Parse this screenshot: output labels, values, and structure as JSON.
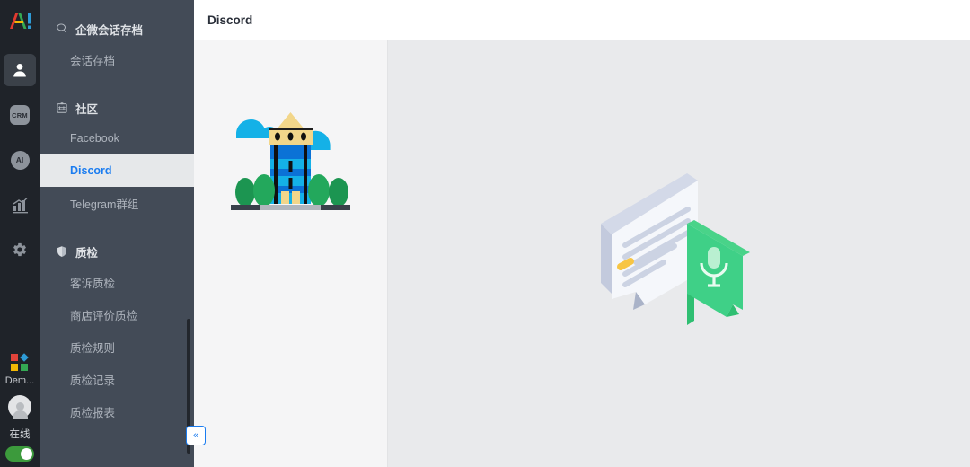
{
  "colors": {
    "rail_bg": "#1f2329",
    "nav_bg": "#434b57",
    "active_item_bg": "#e6e8ea",
    "accent_blue": "#1a7cf0",
    "status_green": "#3c9a3c",
    "pane_list_bg": "#f5f5f6",
    "pane_detail_bg": "#e9eaec"
  },
  "rail": {
    "logo_text": "AI",
    "items": [
      {
        "id": "contacts",
        "icon": "user-icon",
        "label": "",
        "active": true
      },
      {
        "id": "crm",
        "icon": "crm-icon",
        "label": "CRM",
        "active": false
      },
      {
        "id": "ai",
        "icon": "ai-icon",
        "label": "AI",
        "active": false
      },
      {
        "id": "analytics",
        "icon": "chart-icon",
        "label": "",
        "active": false
      },
      {
        "id": "settings",
        "icon": "gear-icon",
        "label": "",
        "active": false
      }
    ],
    "tenant_label": "Dem...",
    "status_label": "在线",
    "status_on": true
  },
  "nav": {
    "groups": [
      {
        "id": "wecom-archive",
        "icon": "chat-bubble-icon",
        "title": "企微会话存档",
        "items": [
          {
            "id": "session-archive",
            "label": "会话存档",
            "active": false
          }
        ]
      },
      {
        "id": "community",
        "icon": "hash-board-icon",
        "title": "社区",
        "items": [
          {
            "id": "facebook",
            "label": "Facebook",
            "active": false
          },
          {
            "id": "discord",
            "label": "Discord",
            "active": true
          },
          {
            "id": "telegram-group",
            "label": "Telegram群组",
            "active": false
          }
        ]
      },
      {
        "id": "quality-inspection",
        "icon": "shield-icon",
        "title": "质检",
        "items": [
          {
            "id": "complaint-qc",
            "label": "客诉质检",
            "active": false
          },
          {
            "id": "store-review-qc",
            "label": "商店评价质检",
            "active": false
          },
          {
            "id": "qc-rules",
            "label": "质检规则",
            "active": false
          },
          {
            "id": "qc-records",
            "label": "质检记录",
            "active": false
          },
          {
            "id": "qc-reports",
            "label": "质检报表",
            "active": false
          }
        ]
      }
    ],
    "collapse_glyph": "«"
  },
  "topbar": {
    "title": "Discord"
  },
  "panes": {
    "list_pane": {
      "illustration": "city-building-illustration",
      "items": []
    },
    "detail_pane": {
      "illustration": "chat-voice-bubble-illustration",
      "message": ""
    }
  }
}
